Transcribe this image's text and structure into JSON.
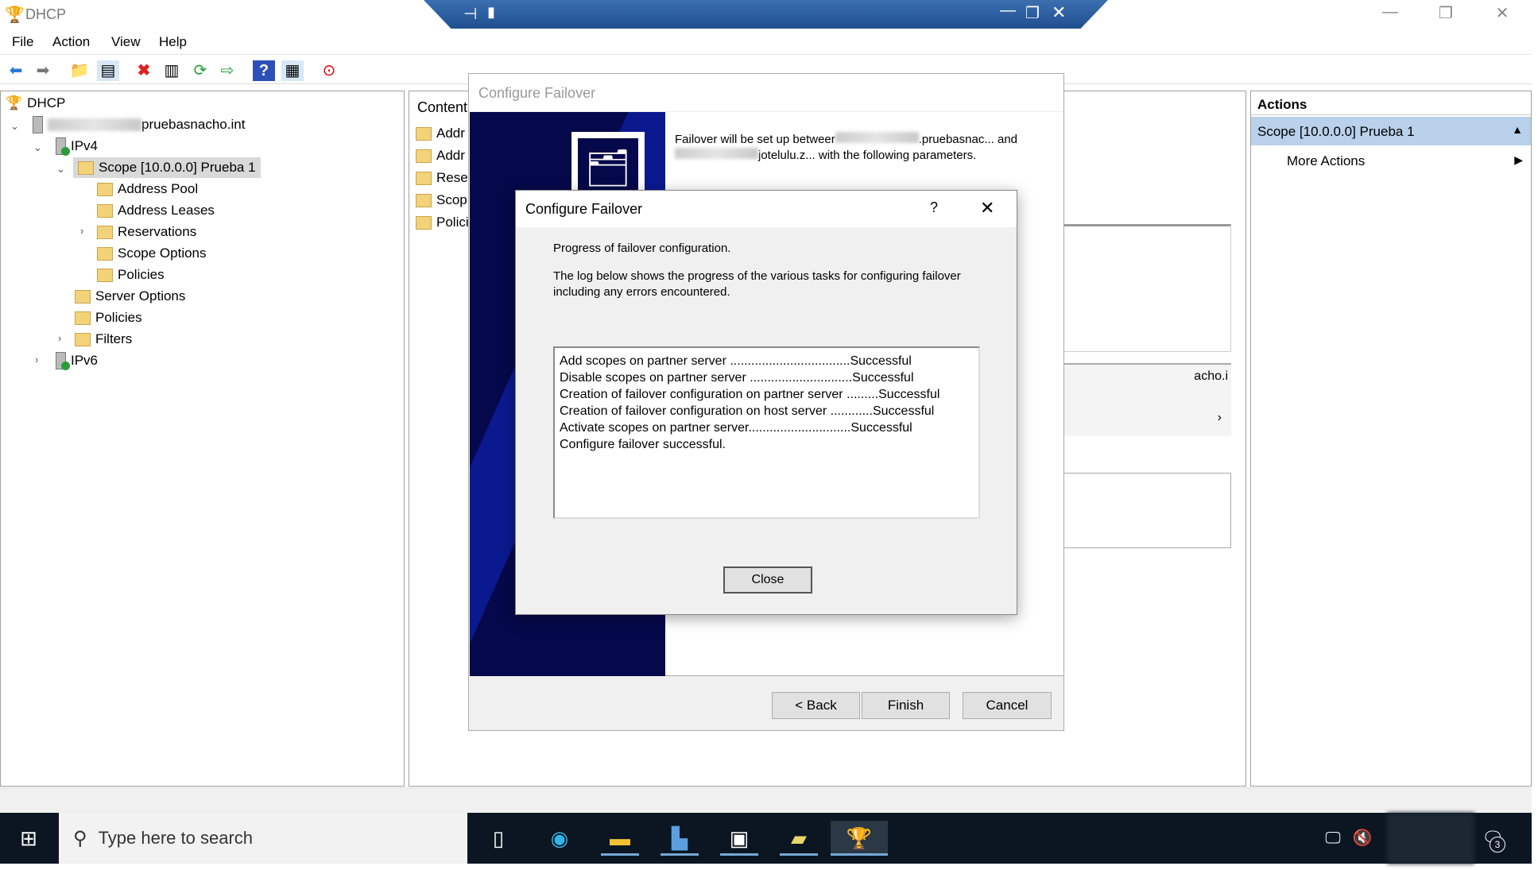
{
  "app": {
    "title": "DHCP"
  },
  "menu": [
    "File",
    "Action",
    "View",
    "Help"
  ],
  "tree": {
    "root": "DHCP",
    "server": "pruebasnacho.int",
    "ipv4": "IPv4",
    "scope": "Scope [10.0.0.0] Prueba 1",
    "scope_children": [
      "Address Pool",
      "Address Leases",
      "Reservations",
      "Scope Options",
      "Policies"
    ],
    "ipv4_children": [
      "Server Options",
      "Policies",
      "Filters"
    ],
    "ipv6": "IPv6"
  },
  "middle": {
    "header": "Content",
    "items": [
      "Addr",
      "Addr",
      "Reser",
      "Scop",
      "Polici"
    ],
    "partial_text": "acho.i"
  },
  "actions": {
    "header": "Actions",
    "selected": "Scope [10.0.0.0] Prueba 1",
    "more": "More Actions"
  },
  "wizard": {
    "title": "Configure Failover",
    "line1_a": "Failover will be set up betweer",
    "line1_b": ".pruebasnac... and",
    "line2": "jotelulu.z... with the following parameters.",
    "back": "< Back",
    "finish": "Finish",
    "cancel": "Cancel"
  },
  "dialog": {
    "title": "Configure Failover",
    "help": "?",
    "heading": "Progress of failover configuration.",
    "desc": "The log below shows the progress of the various tasks for configuring failover including any errors encountered.",
    "log": [
      "Add scopes on partner server ..................................Successful",
      "Disable scopes on partner server .............................Successful",
      "Creation of failover configuration on partner server .........Successful",
      "Creation of failover configuration on host server ............Successful",
      "Activate scopes on partner server.............................Successful",
      "Configure failover successful."
    ],
    "close": "Close"
  },
  "taskbar": {
    "search_placeholder": "Type here to search",
    "notification_count": "3"
  }
}
